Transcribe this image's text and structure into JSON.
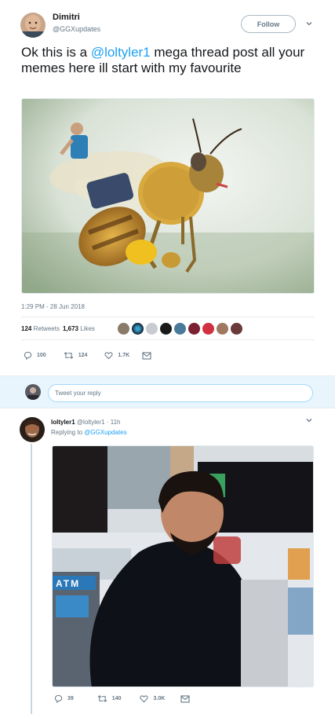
{
  "tweet": {
    "author_name": "Dimitri",
    "author_handle": "@GGXupdates",
    "follow_label": "Follow",
    "text_before": "Ok this is a ",
    "text_mention": "@loltyler1",
    "text_after": " mega thread  post all your memes here ill start with my favourite",
    "timestamp": "1:29 PM - 28 Jun 2018",
    "retweets_count": "124",
    "retweets_label": "Retweets",
    "likes_count": "1,673",
    "likes_label": "Likes",
    "actions": {
      "reply_count": "100",
      "retweet_count": "124",
      "like_count": "1.7K"
    }
  },
  "reply_box": {
    "placeholder": "Tweet your reply"
  },
  "reply_tweet": {
    "author_name": "loltyler1",
    "author_handle": "@loltyler1",
    "time": "· 11h",
    "replying_prefix": "Replying to ",
    "replying_to": "@GGXupdates",
    "actions": {
      "reply_count": "39",
      "retweet_count": "140",
      "like_count": "3.0K"
    },
    "atm_sign": "ATM"
  },
  "colors": {
    "accent": "#1da1f2",
    "secondary_text": "#657786",
    "border": "#e6ecf0",
    "reply_bar_bg": "#e8f5fd"
  },
  "icons": [
    "reply-icon",
    "retweet-icon",
    "like-icon",
    "message-icon",
    "chevron-down-icon"
  ]
}
